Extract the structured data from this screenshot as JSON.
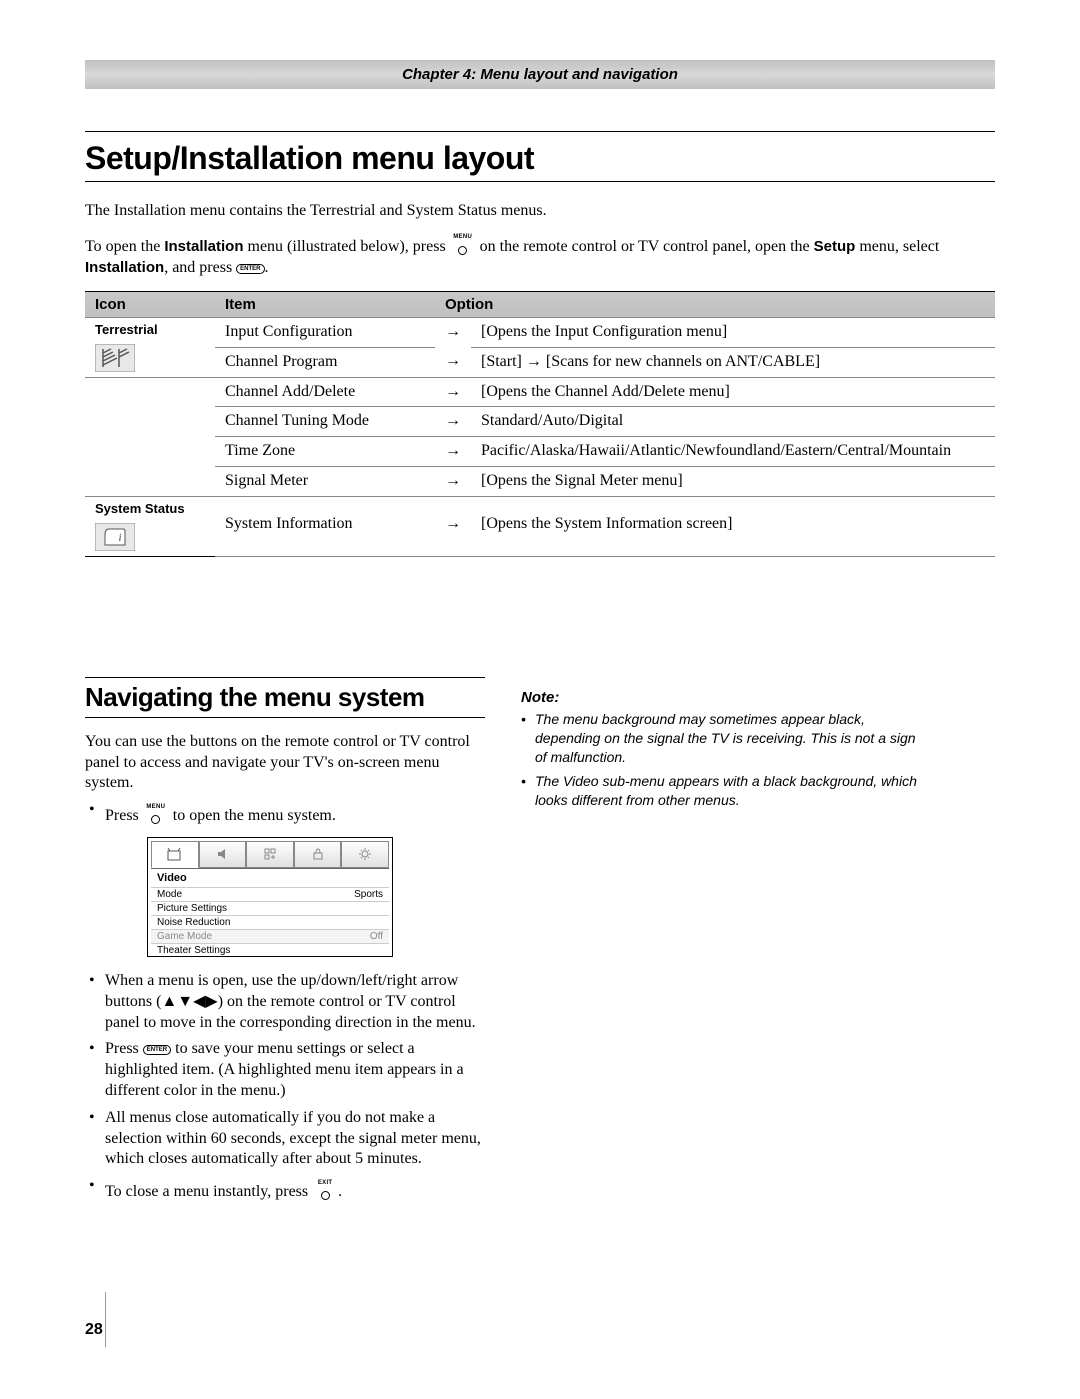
{
  "chapter_banner": "Chapter 4: Menu layout and navigation",
  "title1": "Setup/Installation menu layout",
  "intro1": "The Installation menu contains the Terrestrial and System Status menus.",
  "intro2_a": "To open the ",
  "intro2_b": " menu (illustrated below), press ",
  "intro2_c": " on the remote control or TV control panel, open the ",
  "intro2_d": " menu, select ",
  "intro2_e": ", and press ",
  "label_installation": "Installation",
  "label_setup": "Setup",
  "btn_menu": "MENU",
  "btn_enter": "ENTER",
  "btn_exit": "EXIT",
  "table": {
    "headers": {
      "icon": "Icon",
      "item": "Item",
      "option": "Option"
    },
    "groups": [
      {
        "name": "Terrestrial",
        "icon": "antenna",
        "rows": [
          {
            "item": "Input Configuration",
            "option": "[Opens the Input Configuration menu]"
          },
          {
            "item": "Channel Program",
            "option": "[Start] → [Scans for new channels on ANT/CABLE]"
          },
          {
            "item": "Channel Add/Delete",
            "option": "[Opens the Channel Add/Delete menu]"
          },
          {
            "item": "Channel Tuning Mode",
            "option": "Standard/Auto/Digital"
          },
          {
            "item": "Time Zone",
            "option": "Pacific/Alaska/Hawaii/Atlantic/Newfoundland/Eastern/Central/Mountain"
          },
          {
            "item": "Signal Meter",
            "option": "[Opens the Signal Meter menu]"
          }
        ]
      },
      {
        "name": "System Status",
        "icon": "info",
        "rows": [
          {
            "item": "System Information",
            "option": "[Opens the System Information screen]"
          }
        ]
      }
    ]
  },
  "title2": "Navigating the menu system",
  "nav_intro": "You can use the buttons on the remote control or TV control panel to access and navigate your TV's on-screen menu system.",
  "nav_bullets": [
    {
      "pre": "Press ",
      "btn": "MENU",
      "post": " to open the menu system."
    },
    {
      "text": "When a menu is open, use the up/down/left/right arrow buttons (▲▼◀▶) on the remote control or TV control panel to move in the corresponding direction in the menu."
    },
    {
      "pre": "Press ",
      "pill": "ENTER",
      "post": " to save your menu settings or select a highlighted item. (A highlighted menu item appears in a different color in the menu.)"
    },
    {
      "text": "All menus close automatically if you do not make a selection within 60 seconds, except the signal meter menu, which closes automatically after about 5 minutes."
    },
    {
      "pre": "To close a menu instantly, press ",
      "btn": "EXIT",
      "post": "."
    }
  ],
  "osd": {
    "heading": "Video",
    "rows": [
      {
        "label": "Mode",
        "value": "Sports",
        "dim": false
      },
      {
        "label": "Picture Settings",
        "value": "",
        "dim": false
      },
      {
        "label": "Noise Reduction",
        "value": "",
        "dim": false
      },
      {
        "label": "Game Mode",
        "value": "Off",
        "dim": true
      },
      {
        "label": "Theater Settings",
        "value": "",
        "dim": false
      }
    ]
  },
  "note_head": "Note:",
  "notes": [
    "The menu background may sometimes appear black, depending on the signal the TV is receiving. This is not a sign of malfunction.",
    "The Video sub-menu appears with a black background, which looks different from other menus."
  ],
  "page_number": "28"
}
